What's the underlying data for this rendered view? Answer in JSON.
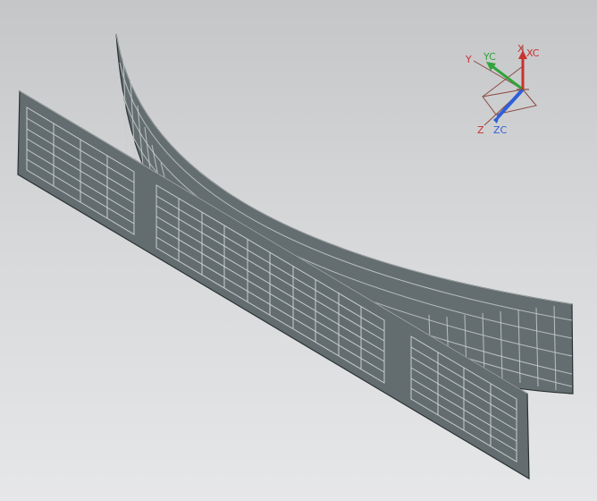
{
  "viewport": {
    "background_top": "#c5c6c8",
    "background_bottom": "#e6e7e8"
  },
  "model": {
    "panel_fill": "#636d6f",
    "panel_edge": "#2a3133",
    "cell_stroke": "#c9cdcd",
    "front_panel": {
      "grid_blocks": [
        {
          "cols": 4,
          "rows": 6
        },
        {
          "cols": 10,
          "rows": 6
        },
        {
          "cols": 4,
          "rows": 6
        }
      ]
    },
    "curved_panel": {
      "grid_rows": 5
    }
  },
  "triad": {
    "labels": {
      "x": "X",
      "xc": "XC",
      "y": "Y",
      "yc": "YC",
      "z": "Z",
      "zc": "ZC"
    },
    "colors": {
      "x": "#c8322f",
      "y": "#2fa43a",
      "z": "#2f5fd8",
      "neutral": "#8a4a40"
    }
  }
}
